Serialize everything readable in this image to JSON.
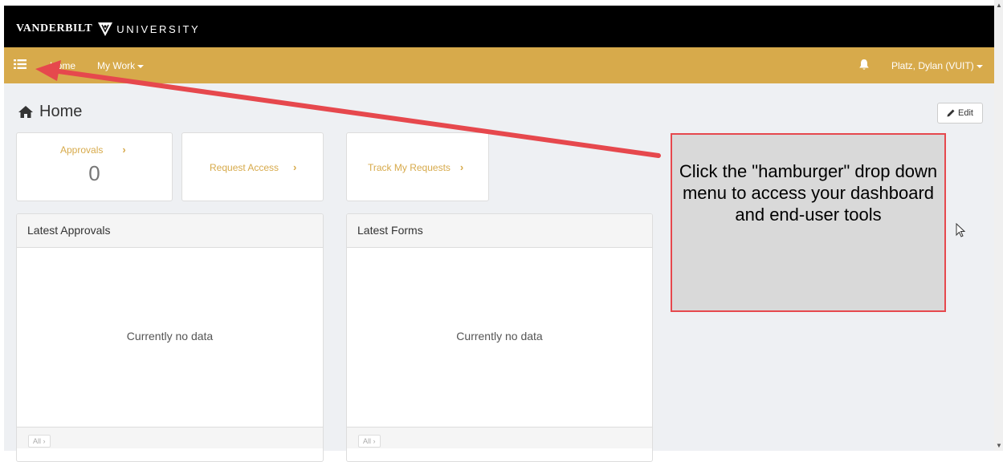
{
  "brand": {
    "name_left": "VANDERBILT",
    "name_right": "UNIVERSITY"
  },
  "nav": {
    "home": "Home",
    "my_work": "My Work",
    "user": "Platz, Dylan (VUIT)"
  },
  "page": {
    "title": "Home",
    "edit": "Edit"
  },
  "tiles": {
    "approvals_label": "Approvals",
    "approvals_count": "0",
    "request_access": "Request Access",
    "track_requests": "Track My Requests",
    "chevron": "›"
  },
  "panels": [
    {
      "title": "Latest Approvals",
      "empty": "Currently no data",
      "footer": "All"
    },
    {
      "title": "Latest Forms",
      "empty": "Currently no data",
      "footer": "All"
    }
  ],
  "callout": {
    "text": "Click the \"hamburger\" drop down menu to access your dashboard and end-user tools"
  },
  "colors": {
    "accent": "#d7aa4b",
    "brand_bar": "#000000",
    "callout_border": "#e6484d",
    "arrow": "#e6484d"
  },
  "icons": [
    "hamburger-menu-icon",
    "bell-icon",
    "home-icon",
    "pencil-icon",
    "chevron-right-icon",
    "mouse-cursor-icon"
  ]
}
